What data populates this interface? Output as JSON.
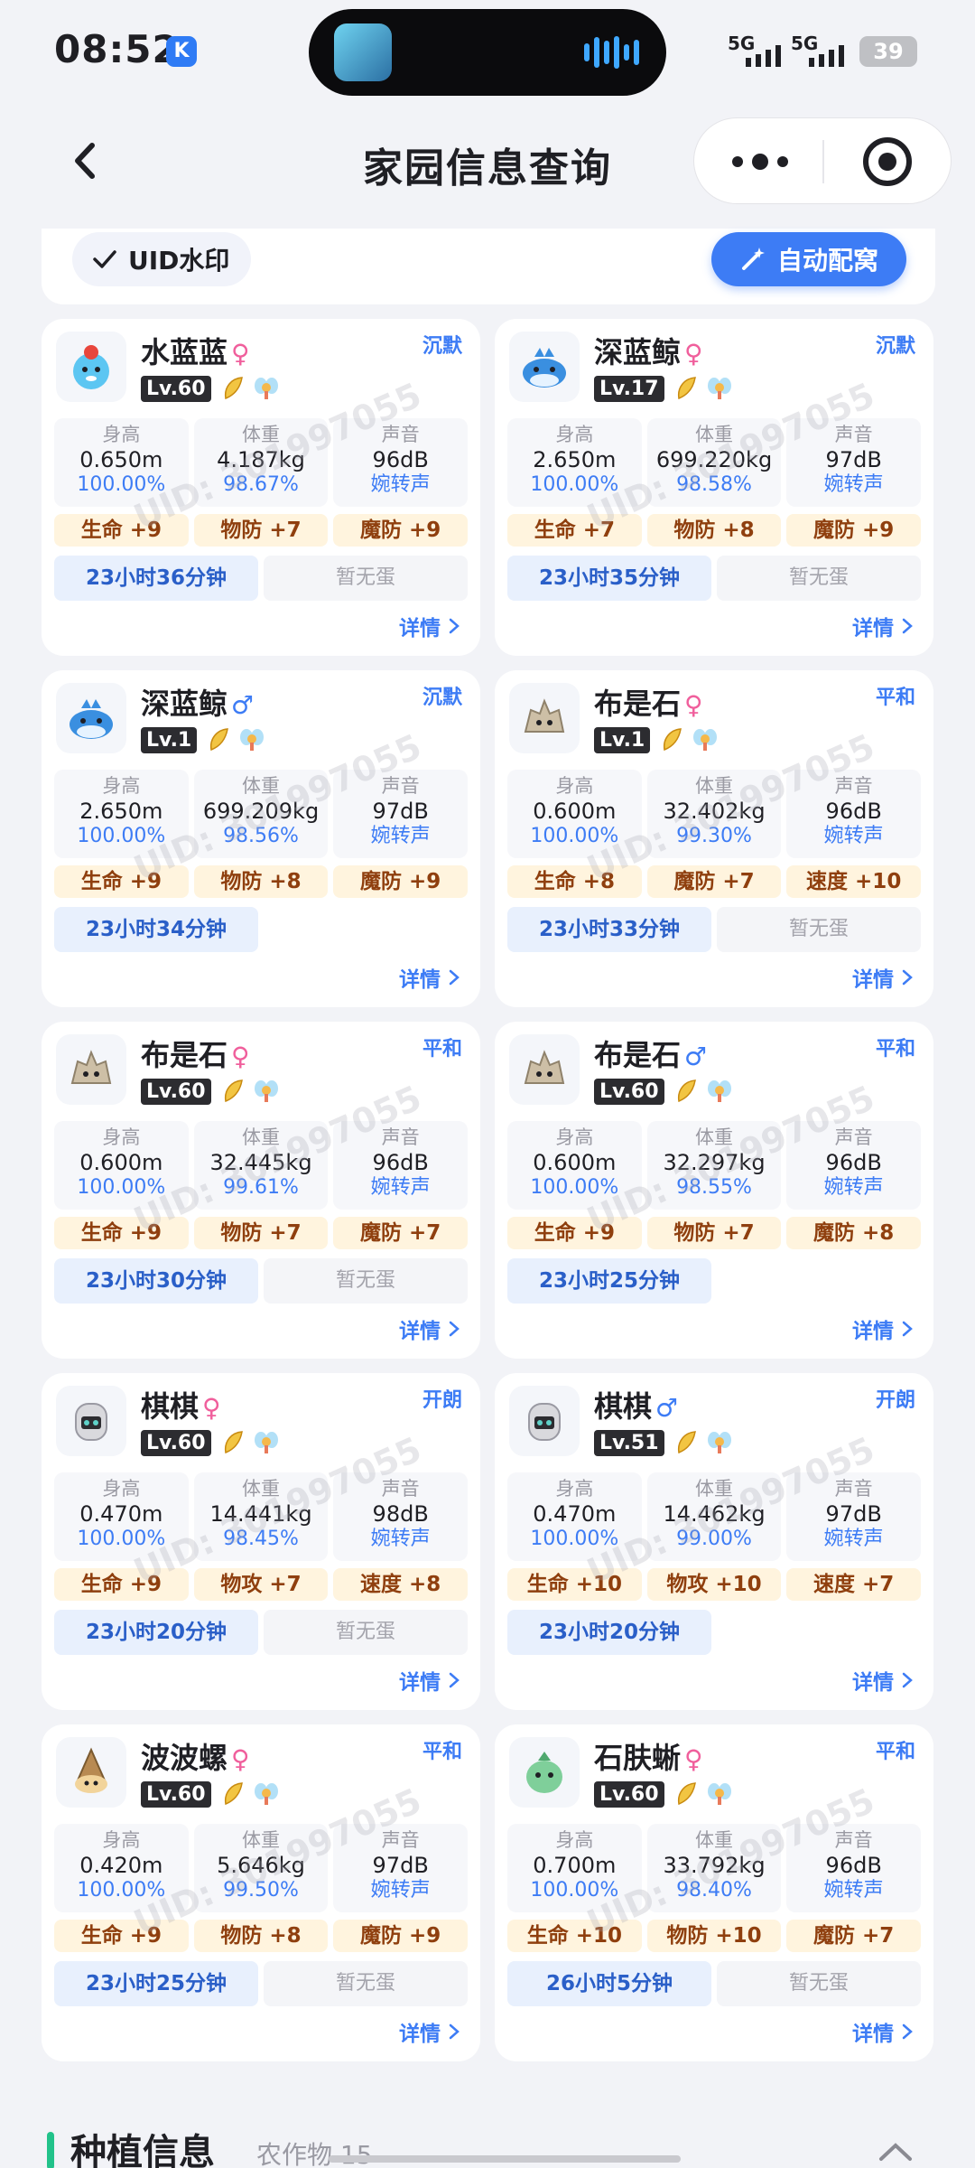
{
  "status": {
    "time": "08:52",
    "signal1": "5G",
    "signal2": "5G",
    "battery": "39"
  },
  "nav": {
    "title": "家园信息查询"
  },
  "toolbar": {
    "uid_label": "UID水印",
    "auto_label": "自动配窝"
  },
  "watermark": "UID: 301997055",
  "labels": {
    "height": "身高",
    "weight": "体重",
    "sound": "声音",
    "detail": "详情"
  },
  "pets": [
    {
      "name": "水蓝蓝",
      "gender": "♀",
      "gender_class": "f",
      "level": "Lv.60",
      "temper": "沉默",
      "height": "0.650m",
      "height_pct": "100.00%",
      "weight": "4.187kg",
      "weight_pct": "98.67%",
      "sound": "96dB",
      "sound_type": "婉转声",
      "bonuses": [
        "生命 +9",
        "物防 +7",
        "魔防 +9"
      ],
      "timer": "23小时36分钟",
      "egg": "暂无蛋",
      "icon": "water-blue-pet-icon",
      "color": "#5cc6f2"
    },
    {
      "name": "深蓝鲸",
      "gender": "♀",
      "gender_class": "f",
      "level": "Lv.17",
      "temper": "沉默",
      "height": "2.650m",
      "height_pct": "100.00%",
      "weight": "699.220kg",
      "weight_pct": "98.58%",
      "sound": "97dB",
      "sound_type": "婉转声",
      "bonuses": [
        "生命 +7",
        "物防 +8",
        "魔防 +9"
      ],
      "timer": "23小时35分钟",
      "egg": "暂无蛋",
      "icon": "deep-blue-whale-icon",
      "color": "#3a8fe0"
    },
    {
      "name": "深蓝鲸",
      "gender": "♂",
      "gender_class": "m",
      "level": "Lv.1",
      "temper": "沉默",
      "height": "2.650m",
      "height_pct": "100.00%",
      "weight": "699.209kg",
      "weight_pct": "98.56%",
      "sound": "97dB",
      "sound_type": "婉转声",
      "bonuses": [
        "生命 +9",
        "物防 +8",
        "魔防 +9"
      ],
      "timer": "23小时34分钟",
      "egg": "",
      "icon": "deep-blue-whale-icon",
      "color": "#3a8fe0"
    },
    {
      "name": "布是石",
      "gender": "♀",
      "gender_class": "f",
      "level": "Lv.1",
      "temper": "平和",
      "height": "0.600m",
      "height_pct": "100.00%",
      "weight": "32.402kg",
      "weight_pct": "99.30%",
      "sound": "96dB",
      "sound_type": "婉转声",
      "bonuses": [
        "生命 +8",
        "魔防 +7",
        "速度 +10"
      ],
      "timer": "23小时33分钟",
      "egg": "暂无蛋",
      "icon": "stone-pet-icon",
      "color": "#cdbfa6"
    },
    {
      "name": "布是石",
      "gender": "♀",
      "gender_class": "f",
      "level": "Lv.60",
      "temper": "平和",
      "height": "0.600m",
      "height_pct": "100.00%",
      "weight": "32.445kg",
      "weight_pct": "99.61%",
      "sound": "96dB",
      "sound_type": "婉转声",
      "bonuses": [
        "生命 +9",
        "物防 +7",
        "魔防 +7"
      ],
      "timer": "23小时30分钟",
      "egg": "暂无蛋",
      "icon": "stone-pet-icon",
      "color": "#cdbfa6"
    },
    {
      "name": "布是石",
      "gender": "♂",
      "gender_class": "m",
      "level": "Lv.60",
      "temper": "平和",
      "height": "0.600m",
      "height_pct": "100.00%",
      "weight": "32.297kg",
      "weight_pct": "98.55%",
      "sound": "96dB",
      "sound_type": "婉转声",
      "bonuses": [
        "生命 +9",
        "物防 +7",
        "魔防 +8"
      ],
      "timer": "23小时25分钟",
      "egg": "",
      "icon": "stone-pet-icon",
      "color": "#cdbfa6"
    },
    {
      "name": "棋棋",
      "gender": "♀",
      "gender_class": "f",
      "level": "Lv.60",
      "temper": "开朗",
      "height": "0.470m",
      "height_pct": "100.00%",
      "weight": "14.441kg",
      "weight_pct": "98.45%",
      "sound": "98dB",
      "sound_type": "婉转声",
      "bonuses": [
        "生命 +9",
        "物攻 +7",
        "速度 +8"
      ],
      "timer": "23小时20分钟",
      "egg": "暂无蛋",
      "icon": "chess-pet-icon",
      "color": "#d9d9dd"
    },
    {
      "name": "棋棋",
      "gender": "♂",
      "gender_class": "m",
      "level": "Lv.51",
      "temper": "开朗",
      "height": "0.470m",
      "height_pct": "100.00%",
      "weight": "14.462kg",
      "weight_pct": "99.00%",
      "sound": "97dB",
      "sound_type": "婉转声",
      "bonuses": [
        "生命 +10",
        "物攻 +10",
        "速度 +7"
      ],
      "timer": "23小时20分钟",
      "egg": "",
      "icon": "chess-pet-icon",
      "color": "#d9d9dd"
    },
    {
      "name": "波波螺",
      "gender": "♀",
      "gender_class": "f",
      "level": "Lv.60",
      "temper": "平和",
      "height": "0.420m",
      "height_pct": "100.00%",
      "weight": "5.646kg",
      "weight_pct": "99.50%",
      "sound": "97dB",
      "sound_type": "婉转声",
      "bonuses": [
        "生命 +9",
        "物防 +8",
        "魔防 +9"
      ],
      "timer": "23小时25分钟",
      "egg": "暂无蛋",
      "icon": "snail-pet-icon",
      "color": "#b88a52"
    },
    {
      "name": "石肤蜥",
      "gender": "♀",
      "gender_class": "f",
      "level": "Lv.60",
      "temper": "平和",
      "height": "0.700m",
      "height_pct": "100.00%",
      "weight": "33.792kg",
      "weight_pct": "98.40%",
      "sound": "96dB",
      "sound_type": "婉转声",
      "bonuses": [
        "生命 +10",
        "物防 +10",
        "魔防 +7"
      ],
      "timer": "26小时5分钟",
      "egg": "暂无蛋",
      "icon": "lizard-pet-icon",
      "color": "#7fcf9a"
    }
  ],
  "plant": {
    "title": "种植信息",
    "count": "农作物 15"
  }
}
